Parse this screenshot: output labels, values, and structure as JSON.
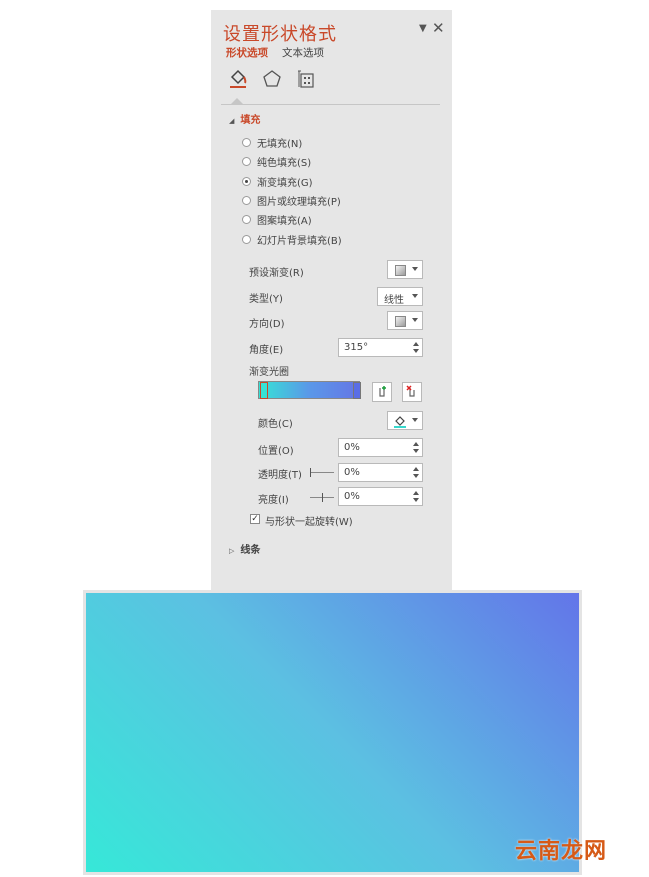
{
  "pane": {
    "title": "设置形状格式",
    "close_glyph": "✕",
    "tabs": [
      "形状选项",
      "文本选项"
    ],
    "icon_tabs": [
      "fill-line-icon",
      "effects-pentagon-icon",
      "size-properties-icon"
    ],
    "fill_section": "填充",
    "fill_options": [
      {
        "label": "无填充(N)",
        "selected": false
      },
      {
        "label": "纯色填充(S)",
        "selected": false
      },
      {
        "label": "渐变填充(G)",
        "selected": true
      },
      {
        "label": "图片或纹理填充(P)",
        "selected": false
      },
      {
        "label": "图案填充(A)",
        "selected": false
      },
      {
        "label": "幻灯片背景填充(B)",
        "selected": false
      }
    ],
    "preset_gradient_label": "预设渐变(R)",
    "type_label": "类型(Y)",
    "type_value": "线性",
    "direction_label": "方向(D)",
    "angle_label": "角度(E)",
    "angle_value": "315°",
    "gradient_stops_label": "渐变光圈",
    "color_label": "颜色(C)",
    "position_label": "位置(O)",
    "position_value": "0%",
    "transparency_label": "透明度(T)",
    "transparency_value": "0%",
    "brightness_label": "亮度(I)",
    "brightness_value": "0%",
    "rotate_with_shape_label": "与形状一起旋转(W)",
    "rotate_with_shape_checked": true,
    "line_section": "线条"
  },
  "gradient_colors": [
    "#36e8d8",
    "#5cc0e2",
    "#6375e9"
  ],
  "accent_color": "#c9492a",
  "watermark": "云南龙网"
}
